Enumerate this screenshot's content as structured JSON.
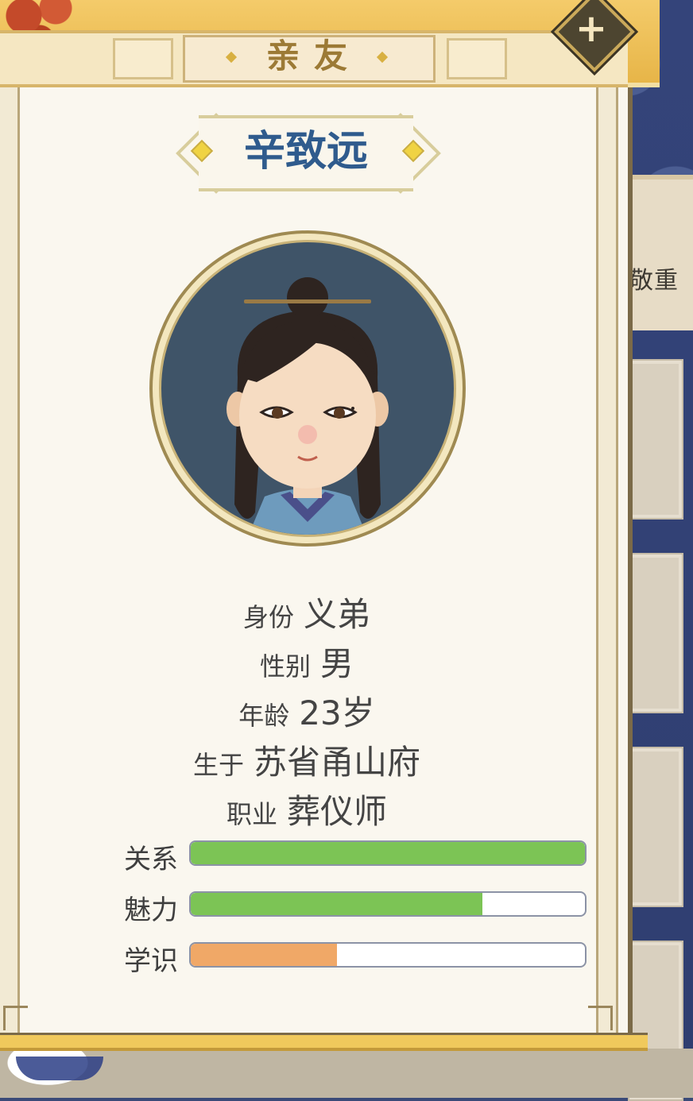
{
  "header": {
    "title": "亲友"
  },
  "character": {
    "name": "辛致远",
    "info": [
      {
        "label": "身份",
        "value": "义弟"
      },
      {
        "label": "性别",
        "value": "男"
      },
      {
        "label": "年龄",
        "value": "23岁"
      },
      {
        "label": "生于",
        "value": "苏省甬山府"
      },
      {
        "label": "职业",
        "value": "葬仪师"
      }
    ],
    "stats": [
      {
        "label": "关系",
        "value": 1.0,
        "color": "#7cc455"
      },
      {
        "label": "魅力",
        "value": 0.74,
        "color": "#7cc455"
      },
      {
        "label": "学识",
        "value": 0.37,
        "color": "#f0a867"
      }
    ]
  },
  "background": {
    "banner_text": "敬重"
  },
  "icons": {
    "close": "close-icon",
    "avatar": "character-portrait"
  }
}
